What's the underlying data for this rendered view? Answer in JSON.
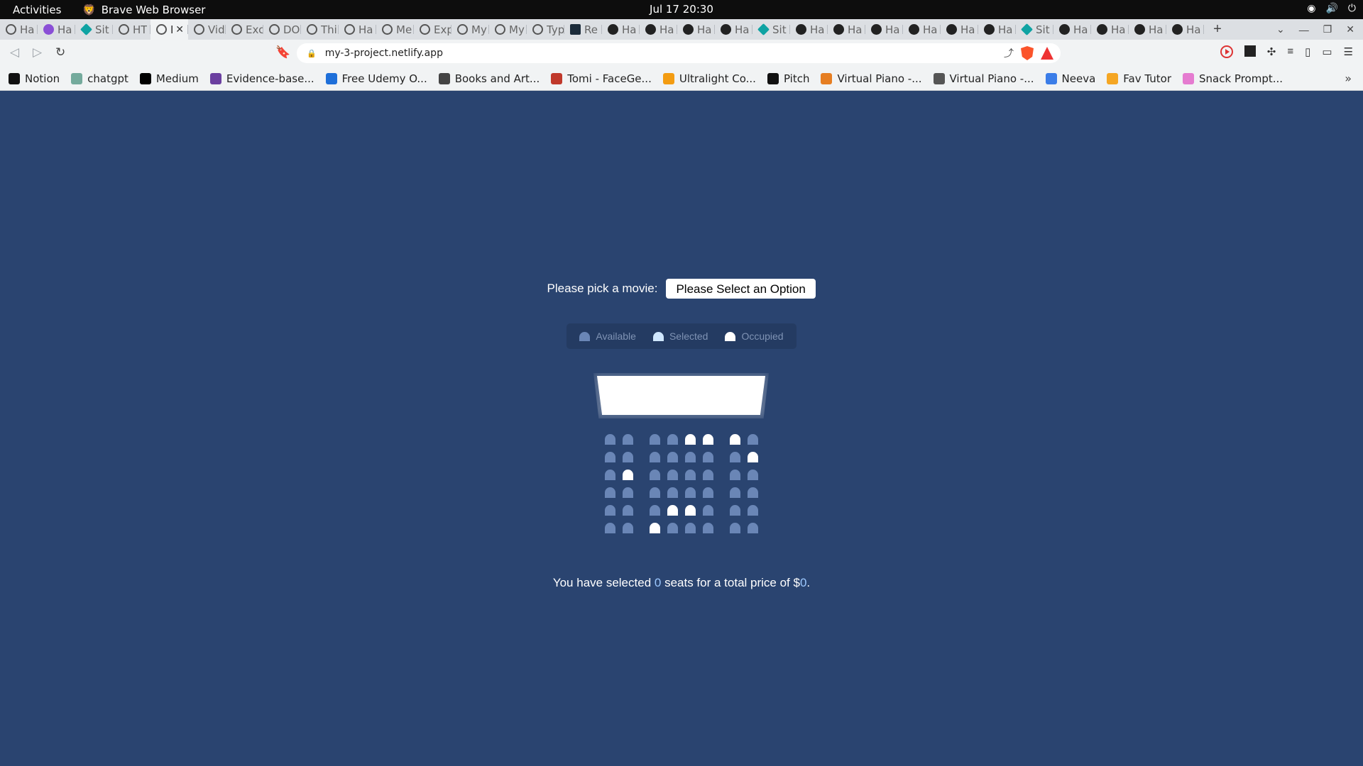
{
  "system": {
    "activities": "Activities",
    "app_name": "Brave Web Browser",
    "clock": "Jul 17  20:30"
  },
  "tabs": [
    {
      "label": "Ha",
      "icon": "openai-icon"
    },
    {
      "label": "Ha",
      "icon": "purple-icon"
    },
    {
      "label": "Sit",
      "icon": "teal-icon"
    },
    {
      "label": "HT",
      "icon": "globe-icon"
    },
    {
      "label": "I",
      "icon": "globe-icon",
      "active": true
    },
    {
      "label": "Vid",
      "icon": "globe-icon"
    },
    {
      "label": "Exc",
      "icon": "globe-icon"
    },
    {
      "label": "DO",
      "icon": "globe-icon"
    },
    {
      "label": "Thi",
      "icon": "globe-icon"
    },
    {
      "label": "Ha",
      "icon": "globe-icon"
    },
    {
      "label": "Me",
      "icon": "globe-icon"
    },
    {
      "label": "Exp",
      "icon": "globe-icon"
    },
    {
      "label": "My",
      "icon": "globe-icon"
    },
    {
      "label": "My",
      "icon": "globe-icon"
    },
    {
      "label": "Typ",
      "icon": "globe-icon"
    },
    {
      "label": "Re",
      "icon": "react-icon"
    },
    {
      "label": "Ha",
      "icon": "github-icon"
    },
    {
      "label": "Ha",
      "icon": "github-icon"
    },
    {
      "label": "Ha",
      "icon": "github-icon"
    },
    {
      "label": "Ha",
      "icon": "github-icon"
    },
    {
      "label": "Sit",
      "icon": "teal-icon"
    },
    {
      "label": "Ha",
      "icon": "github-icon"
    },
    {
      "label": "Ha",
      "icon": "github-icon"
    },
    {
      "label": "Ha",
      "icon": "github-icon"
    },
    {
      "label": "Ha",
      "icon": "github-icon"
    },
    {
      "label": "Ha",
      "icon": "github-icon"
    },
    {
      "label": "Ha",
      "icon": "github-icon"
    },
    {
      "label": "Sit",
      "icon": "teal-icon"
    },
    {
      "label": "Ha",
      "icon": "github-icon"
    },
    {
      "label": "Ha",
      "icon": "github-icon"
    },
    {
      "label": "Ha",
      "icon": "github-icon"
    },
    {
      "label": "Ha",
      "icon": "github-icon"
    }
  ],
  "address_bar": {
    "url": "my-3-project.netlify.app"
  },
  "bookmarks": [
    {
      "label": "Notion",
      "color": "#111111"
    },
    {
      "label": "chatgpt",
      "color": "#74aa9c"
    },
    {
      "label": "Medium",
      "color": "#000000"
    },
    {
      "label": "Evidence-base...",
      "color": "#6b3fa0"
    },
    {
      "label": "Free Udemy O...",
      "color": "#1e6fd9"
    },
    {
      "label": "Books and Art...",
      "color": "#444444"
    },
    {
      "label": "Tomi - FaceGe...",
      "color": "#c0392b"
    },
    {
      "label": "Ultralight Co...",
      "color": "#f39c12"
    },
    {
      "label": "Pitch",
      "color": "#111111"
    },
    {
      "label": "Virtual Piano -...",
      "color": "#e67e22"
    },
    {
      "label": "Virtual Piano -...",
      "color": "#555555"
    },
    {
      "label": "Neeva",
      "color": "#3b7de8"
    },
    {
      "label": "Fav Tutor",
      "color": "#f5a623"
    },
    {
      "label": "Snack Prompt...",
      "color": "#e57bd0"
    }
  ],
  "page": {
    "picker_label": "Please pick a movie:",
    "picker_value": "Please Select an Option",
    "legend": {
      "available": "Available",
      "selected": "Selected",
      "occupied": "Occupied"
    },
    "seats": [
      [
        "available",
        "available",
        "available",
        "available",
        "occupied",
        "occupied",
        "occupied",
        "available"
      ],
      [
        "available",
        "available",
        "available",
        "available",
        "available",
        "available",
        "available",
        "occupied"
      ],
      [
        "available",
        "occupied",
        "available",
        "available",
        "available",
        "available",
        "available",
        "available"
      ],
      [
        "available",
        "available",
        "available",
        "available",
        "available",
        "available",
        "available",
        "available"
      ],
      [
        "available",
        "available",
        "available",
        "occupied",
        "occupied",
        "available",
        "available",
        "available"
      ],
      [
        "available",
        "available",
        "occupied",
        "available",
        "available",
        "available",
        "available",
        "available"
      ]
    ],
    "summary": {
      "prefix": "You have selected ",
      "count": "0",
      "middle": " seats for a total price of $",
      "total": "0",
      "suffix": "."
    }
  },
  "colors": {
    "background": "#2a4470",
    "available": "#6a86b6",
    "selected": "#8fc7ff",
    "occupied": "#ffffff"
  }
}
